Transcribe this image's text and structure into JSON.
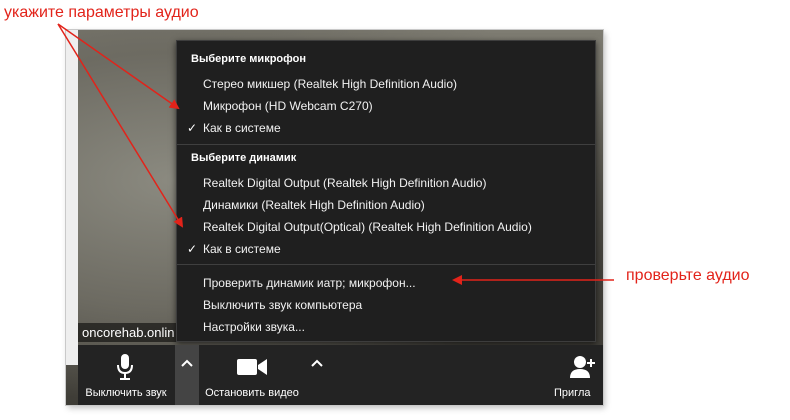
{
  "annotations": {
    "top_note": "укажите параметры аудио",
    "right_note": "проверьте аудио"
  },
  "video": {
    "participant_label": "oncorehab.onlin"
  },
  "audio_menu": {
    "microphone_header": "Выберите микрофон",
    "microphones": [
      {
        "label": "Стерео микшер (Realtek High Definition Audio)",
        "checked": false
      },
      {
        "label": "Микрофон (HD Webcam C270)",
        "checked": false
      },
      {
        "label": "Как в системе",
        "checked": true
      }
    ],
    "speaker_header": "Выберите динамик",
    "speakers": [
      {
        "label": "Realtek Digital Output (Realtek High Definition Audio)",
        "checked": false
      },
      {
        "label": "Динамики (Realtek High Definition Audio)",
        "checked": false
      },
      {
        "label": "Realtek Digital Output(Optical) (Realtek High Definition Audio)",
        "checked": false
      },
      {
        "label": "Как в системе",
        "checked": true
      }
    ],
    "actions": [
      "Проверить динамик иатр; микрофон...",
      "Выключить звук компьютера",
      "Настройки звука..."
    ],
    "check_mark": "✓"
  },
  "toolbar": {
    "mute_label": "Выключить звук",
    "video_label": "Остановить видео",
    "invite_label": "Пригла"
  },
  "colors": {
    "annotation_red": "#e2231a",
    "menu_bg": "#1f1f1f",
    "toolbar_bg": "#232323"
  }
}
